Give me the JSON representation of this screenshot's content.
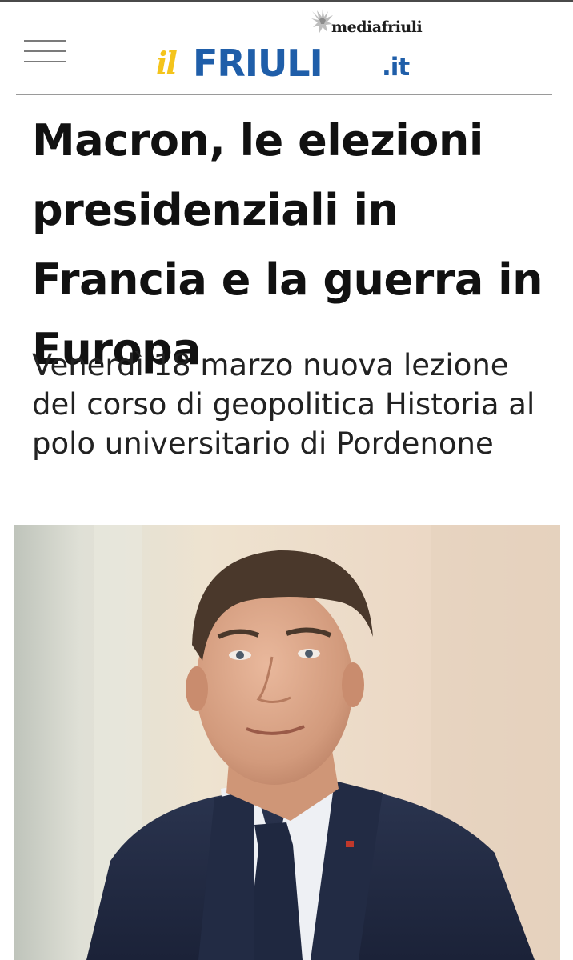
{
  "header": {
    "menu_icon": "hamburger-menu-icon",
    "publisher_label": "mediafriuli",
    "publisher_icon": "eagle-icon",
    "logo": {
      "prefix": "il",
      "name": "FRIULI",
      "suffix": ".it"
    },
    "colors": {
      "logo_blue": "#1f5ea9",
      "logo_yellow": "#f4c41c"
    }
  },
  "article": {
    "headline": "Macron, le elezioni presidenziali in Francia e la guerra in Europa",
    "subtitle": "Venerdì 18 marzo nuova lezione del corso di geopolitica Historia al polo universitario di Pordenone"
  }
}
